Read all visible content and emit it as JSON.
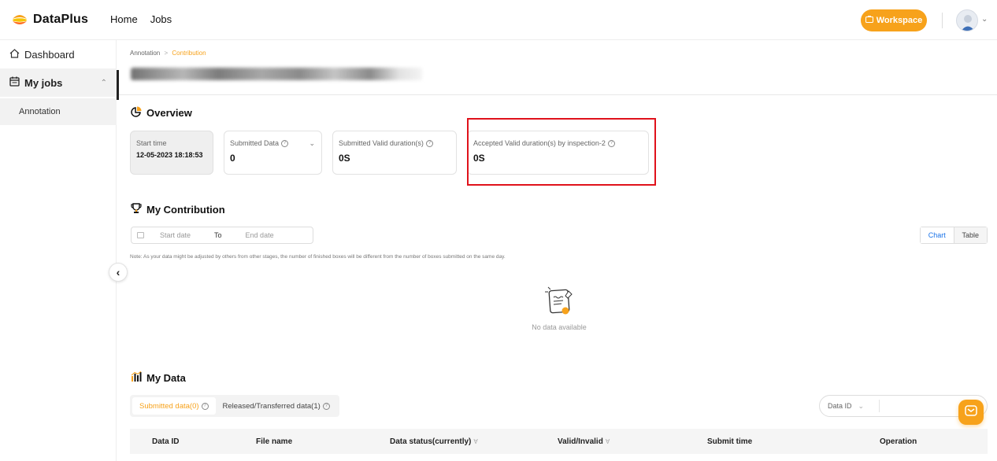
{
  "app": {
    "name": "DataPlus",
    "nav": [
      "Home",
      "Jobs"
    ],
    "workspace_label": "Workspace"
  },
  "sidebar": {
    "dashboard": "Dashboard",
    "my_jobs": "My jobs",
    "annotation": "Annotation"
  },
  "breadcrumb": {
    "root": "Annotation",
    "separator": ">",
    "current": "Contribution"
  },
  "overview": {
    "title": "Overview",
    "cards": [
      {
        "label": "Start time",
        "value": "12-05-2023 18:18:53"
      },
      {
        "label": "Submitted Data",
        "value": "0"
      },
      {
        "label": "Submitted Valid duration(s)",
        "value": "0S"
      },
      {
        "label": "Accepted Valid duration(s) by inspection-2",
        "value": "0S"
      }
    ]
  },
  "contribution": {
    "title": "My Contribution",
    "start_placeholder": "Start date",
    "to_label": "To",
    "end_placeholder": "End date",
    "view_chart": "Chart",
    "view_table": "Table",
    "note": "Note: As your data might be adjusted by others from other stages, the number of finished boxes will be different from the number of boxes submitted on the same day.",
    "empty_text": "No data available"
  },
  "my_data": {
    "title": "My Data",
    "tabs": [
      "Submitted data(0)",
      "Released/Transferred data(1)"
    ],
    "search_field": "Data ID",
    "columns": [
      "Data ID",
      "File name",
      "Data status(currently)",
      "Valid/Invalid",
      "Submit time",
      "Operation"
    ]
  },
  "colors": {
    "accent": "#f7a21b",
    "highlight": "#e0121b",
    "link": "#1a73e8"
  }
}
